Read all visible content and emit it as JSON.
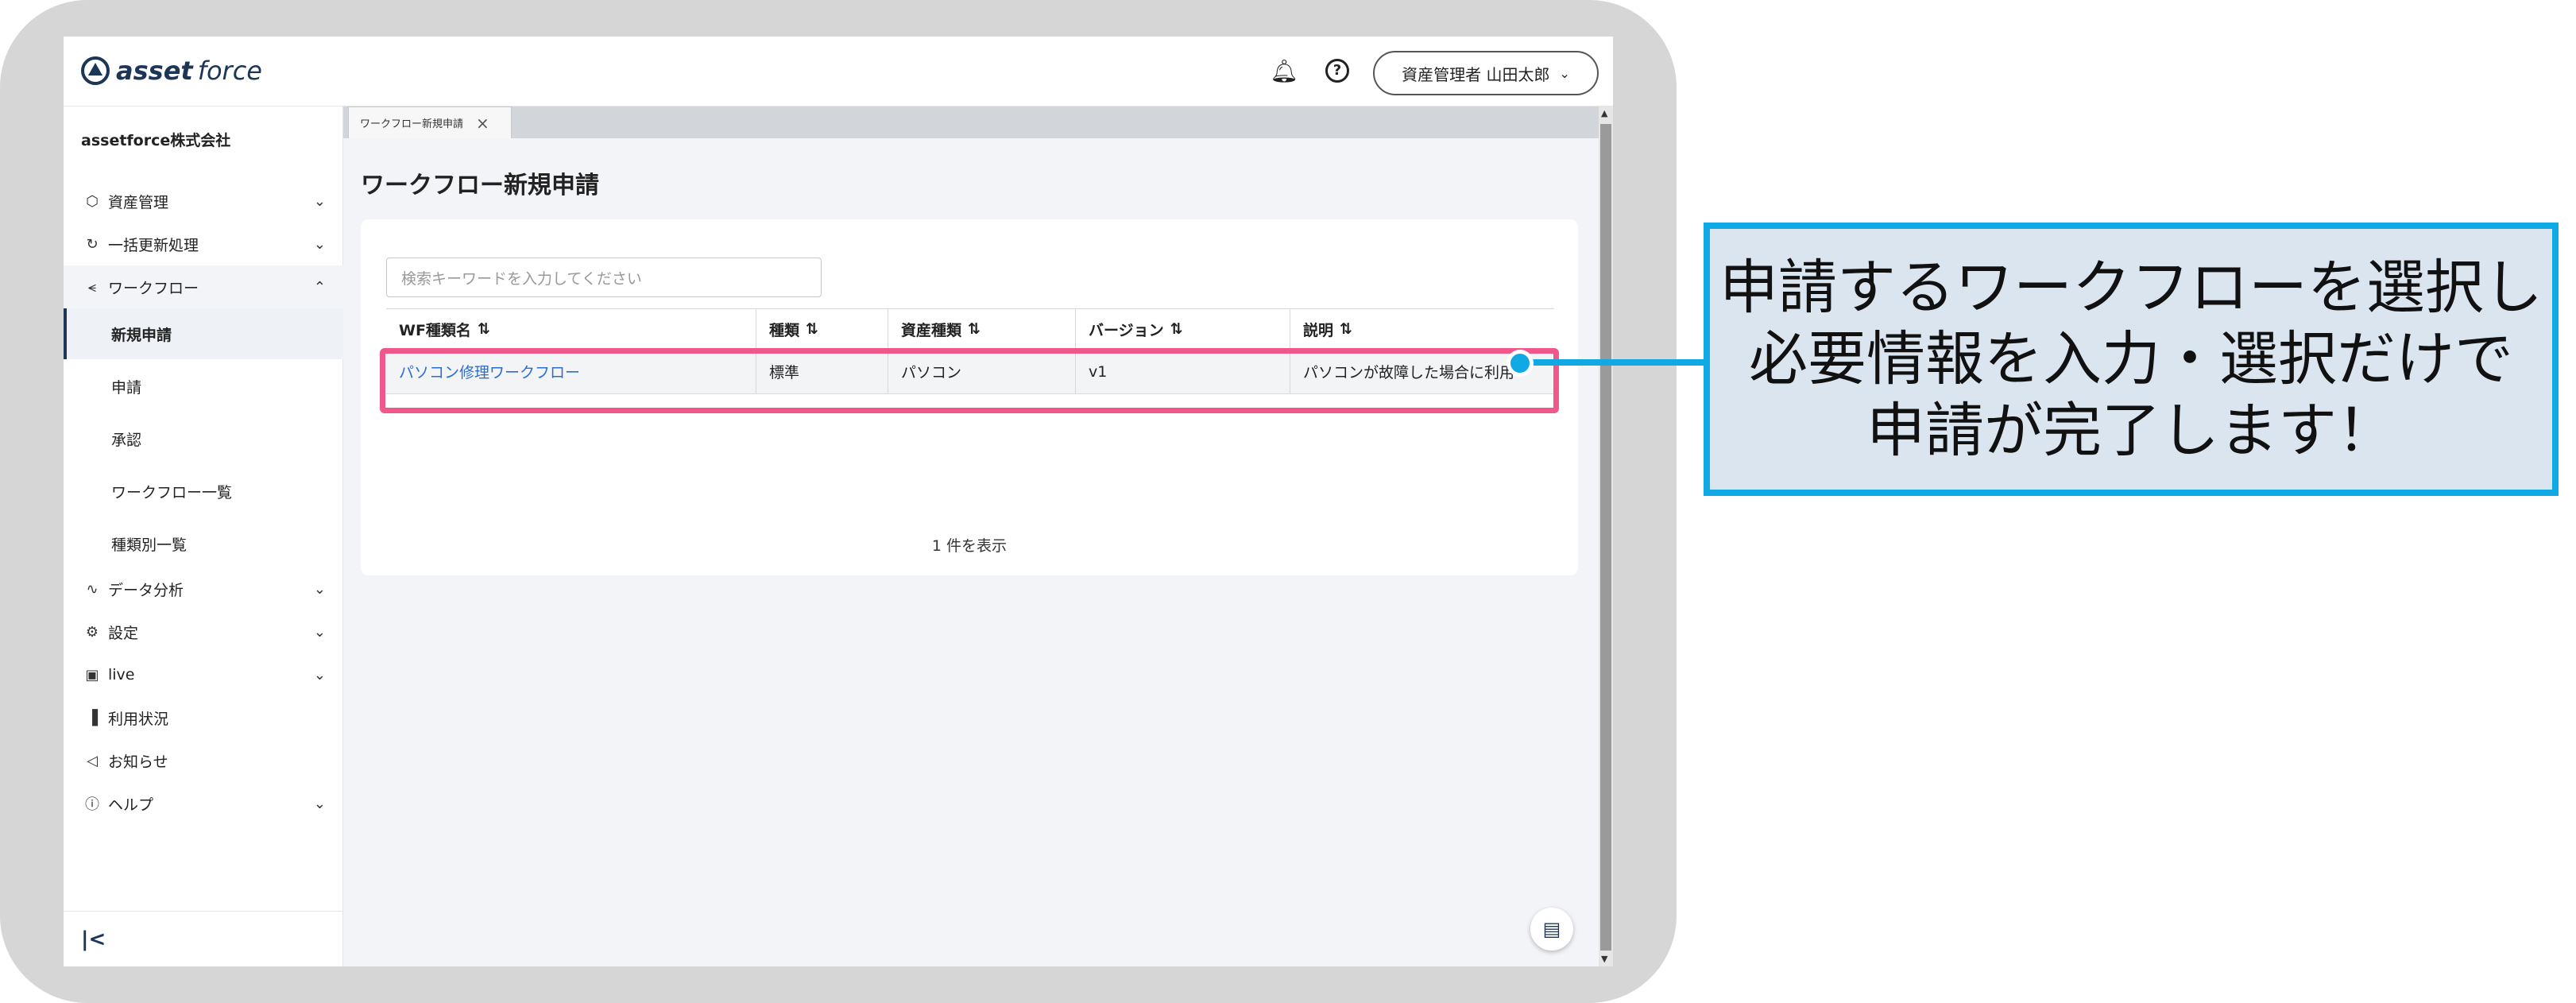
{
  "header": {
    "logo_bold": "asset",
    "logo_light": "force",
    "user_label": "資産管理者 山田太郎"
  },
  "sidebar": {
    "company": "assetforce株式会社",
    "items": [
      {
        "label": "資産管理",
        "icon": "asset-icon"
      },
      {
        "label": "一括更新処理",
        "icon": "refresh-icon"
      },
      {
        "label": "ワークフロー",
        "icon": "workflow-icon"
      },
      {
        "label": "データ分析",
        "icon": "analytics-icon"
      },
      {
        "label": "設定",
        "icon": "settings-icon"
      },
      {
        "label": "live",
        "icon": "live-icon"
      },
      {
        "label": "利用状況",
        "icon": "usage-icon"
      },
      {
        "label": "お知らせ",
        "icon": "announcement-icon"
      },
      {
        "label": "ヘルプ",
        "icon": "help-icon"
      }
    ],
    "workflow_sub": [
      "新規申請",
      "申請",
      "承認",
      "ワークフロー一覧",
      "種類別一覧"
    ]
  },
  "tab": {
    "label": "ワークフロー新規申請"
  },
  "page": {
    "title": "ワークフロー新規申請",
    "search_placeholder": "検索キーワードを入力してください",
    "columns": [
      "WF種類名",
      "種類",
      "資産種類",
      "バージョン",
      "説明"
    ],
    "rows": [
      {
        "name": "パソコン修理ワークフロー",
        "type": "標準",
        "asset_type": "パソコン",
        "version": "v1",
        "desc": "パソコンが故障した場合に利用"
      }
    ],
    "count_text": "1 件を表示"
  },
  "callout": {
    "lines": [
      "申請するワークフローを選択し",
      "必要情報を入力・選択だけで",
      "申請が完了します！"
    ]
  },
  "colors": {
    "brand": "#1d3557",
    "highlight": "#f0588c",
    "callout_border": "#11a9e3",
    "callout_bg": "#dbe5ef",
    "link": "#2b6dd2"
  }
}
